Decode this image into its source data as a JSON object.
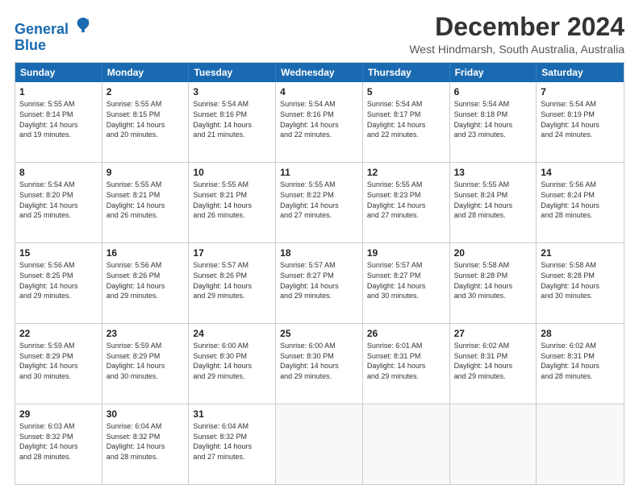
{
  "app": {
    "logo_line1": "General",
    "logo_line2": "Blue"
  },
  "title": "December 2024",
  "location": "West Hindmarsh, South Australia, Australia",
  "days_of_week": [
    "Sunday",
    "Monday",
    "Tuesday",
    "Wednesday",
    "Thursday",
    "Friday",
    "Saturday"
  ],
  "weeks": [
    [
      {
        "day": 1,
        "lines": [
          "Sunrise: 5:55 AM",
          "Sunset: 8:14 PM",
          "Daylight: 14 hours",
          "and 19 minutes."
        ]
      },
      {
        "day": 2,
        "lines": [
          "Sunrise: 5:55 AM",
          "Sunset: 8:15 PM",
          "Daylight: 14 hours",
          "and 20 minutes."
        ]
      },
      {
        "day": 3,
        "lines": [
          "Sunrise: 5:54 AM",
          "Sunset: 8:16 PM",
          "Daylight: 14 hours",
          "and 21 minutes."
        ]
      },
      {
        "day": 4,
        "lines": [
          "Sunrise: 5:54 AM",
          "Sunset: 8:16 PM",
          "Daylight: 14 hours",
          "and 22 minutes."
        ]
      },
      {
        "day": 5,
        "lines": [
          "Sunrise: 5:54 AM",
          "Sunset: 8:17 PM",
          "Daylight: 14 hours",
          "and 22 minutes."
        ]
      },
      {
        "day": 6,
        "lines": [
          "Sunrise: 5:54 AM",
          "Sunset: 8:18 PM",
          "Daylight: 14 hours",
          "and 23 minutes."
        ]
      },
      {
        "day": 7,
        "lines": [
          "Sunrise: 5:54 AM",
          "Sunset: 8:19 PM",
          "Daylight: 14 hours",
          "and 24 minutes."
        ]
      }
    ],
    [
      {
        "day": 8,
        "lines": [
          "Sunrise: 5:54 AM",
          "Sunset: 8:20 PM",
          "Daylight: 14 hours",
          "and 25 minutes."
        ]
      },
      {
        "day": 9,
        "lines": [
          "Sunrise: 5:55 AM",
          "Sunset: 8:21 PM",
          "Daylight: 14 hours",
          "and 26 minutes."
        ]
      },
      {
        "day": 10,
        "lines": [
          "Sunrise: 5:55 AM",
          "Sunset: 8:21 PM",
          "Daylight: 14 hours",
          "and 26 minutes."
        ]
      },
      {
        "day": 11,
        "lines": [
          "Sunrise: 5:55 AM",
          "Sunset: 8:22 PM",
          "Daylight: 14 hours",
          "and 27 minutes."
        ]
      },
      {
        "day": 12,
        "lines": [
          "Sunrise: 5:55 AM",
          "Sunset: 8:23 PM",
          "Daylight: 14 hours",
          "and 27 minutes."
        ]
      },
      {
        "day": 13,
        "lines": [
          "Sunrise: 5:55 AM",
          "Sunset: 8:24 PM",
          "Daylight: 14 hours",
          "and 28 minutes."
        ]
      },
      {
        "day": 14,
        "lines": [
          "Sunrise: 5:56 AM",
          "Sunset: 8:24 PM",
          "Daylight: 14 hours",
          "and 28 minutes."
        ]
      }
    ],
    [
      {
        "day": 15,
        "lines": [
          "Sunrise: 5:56 AM",
          "Sunset: 8:25 PM",
          "Daylight: 14 hours",
          "and 29 minutes."
        ]
      },
      {
        "day": 16,
        "lines": [
          "Sunrise: 5:56 AM",
          "Sunset: 8:26 PM",
          "Daylight: 14 hours",
          "and 29 minutes."
        ]
      },
      {
        "day": 17,
        "lines": [
          "Sunrise: 5:57 AM",
          "Sunset: 8:26 PM",
          "Daylight: 14 hours",
          "and 29 minutes."
        ]
      },
      {
        "day": 18,
        "lines": [
          "Sunrise: 5:57 AM",
          "Sunset: 8:27 PM",
          "Daylight: 14 hours",
          "and 29 minutes."
        ]
      },
      {
        "day": 19,
        "lines": [
          "Sunrise: 5:57 AM",
          "Sunset: 8:27 PM",
          "Daylight: 14 hours",
          "and 30 minutes."
        ]
      },
      {
        "day": 20,
        "lines": [
          "Sunrise: 5:58 AM",
          "Sunset: 8:28 PM",
          "Daylight: 14 hours",
          "and 30 minutes."
        ]
      },
      {
        "day": 21,
        "lines": [
          "Sunrise: 5:58 AM",
          "Sunset: 8:28 PM",
          "Daylight: 14 hours",
          "and 30 minutes."
        ]
      }
    ],
    [
      {
        "day": 22,
        "lines": [
          "Sunrise: 5:59 AM",
          "Sunset: 8:29 PM",
          "Daylight: 14 hours",
          "and 30 minutes."
        ]
      },
      {
        "day": 23,
        "lines": [
          "Sunrise: 5:59 AM",
          "Sunset: 8:29 PM",
          "Daylight: 14 hours",
          "and 30 minutes."
        ]
      },
      {
        "day": 24,
        "lines": [
          "Sunrise: 6:00 AM",
          "Sunset: 8:30 PM",
          "Daylight: 14 hours",
          "and 29 minutes."
        ]
      },
      {
        "day": 25,
        "lines": [
          "Sunrise: 6:00 AM",
          "Sunset: 8:30 PM",
          "Daylight: 14 hours",
          "and 29 minutes."
        ]
      },
      {
        "day": 26,
        "lines": [
          "Sunrise: 6:01 AM",
          "Sunset: 8:31 PM",
          "Daylight: 14 hours",
          "and 29 minutes."
        ]
      },
      {
        "day": 27,
        "lines": [
          "Sunrise: 6:02 AM",
          "Sunset: 8:31 PM",
          "Daylight: 14 hours",
          "and 29 minutes."
        ]
      },
      {
        "day": 28,
        "lines": [
          "Sunrise: 6:02 AM",
          "Sunset: 8:31 PM",
          "Daylight: 14 hours",
          "and 28 minutes."
        ]
      }
    ],
    [
      {
        "day": 29,
        "lines": [
          "Sunrise: 6:03 AM",
          "Sunset: 8:32 PM",
          "Daylight: 14 hours",
          "and 28 minutes."
        ]
      },
      {
        "day": 30,
        "lines": [
          "Sunrise: 6:04 AM",
          "Sunset: 8:32 PM",
          "Daylight: 14 hours",
          "and 28 minutes."
        ]
      },
      {
        "day": 31,
        "lines": [
          "Sunrise: 6:04 AM",
          "Sunset: 8:32 PM",
          "Daylight: 14 hours",
          "and 27 minutes."
        ]
      },
      null,
      null,
      null,
      null
    ]
  ]
}
